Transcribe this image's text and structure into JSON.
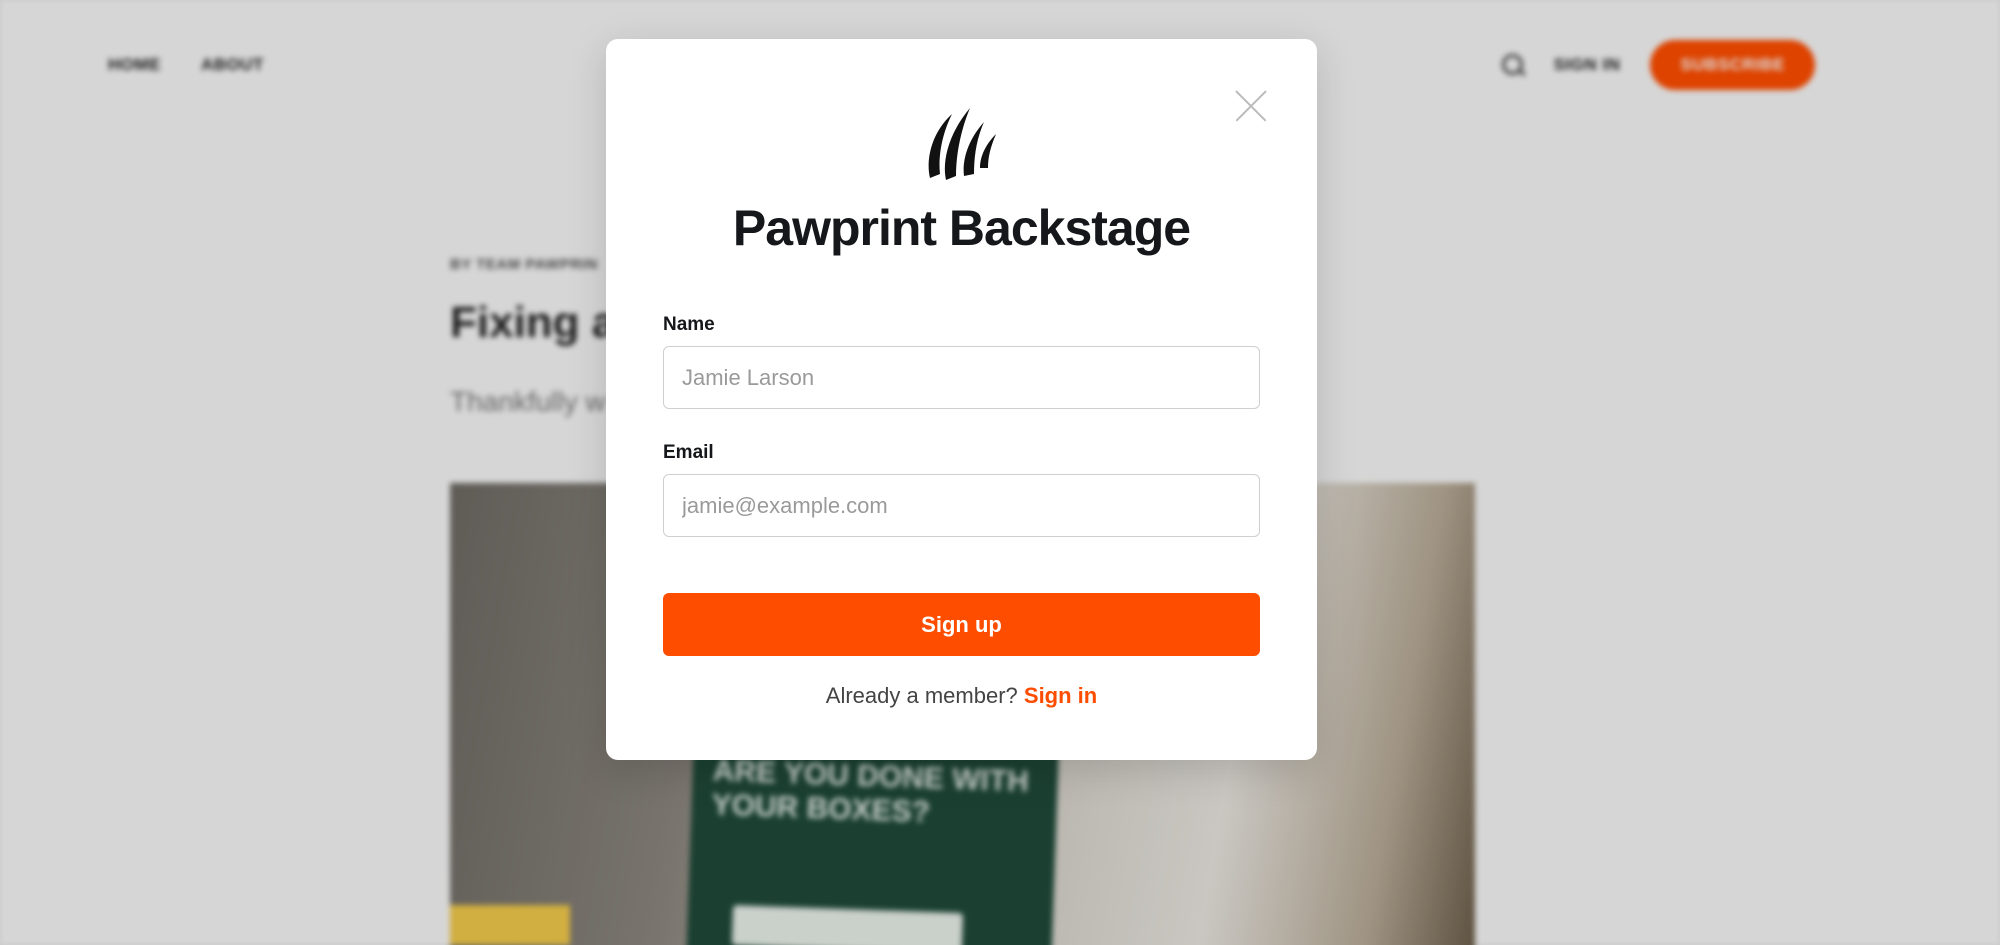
{
  "background_site": {
    "nav_left": [
      "HOME",
      "ABOUT"
    ],
    "sign_in": "SIGN IN",
    "subscribe": "SUBSCRIBE",
    "byline": "BY TEAM PAWPRIN",
    "title_fragment": "Fixing a",
    "subtitle_fragment": "Thankfully w",
    "poster_text": "ARE YOU DONE WITH YOUR BOXES?"
  },
  "modal": {
    "brand_name": "Pawprint Backstage",
    "logo_icon": "claw-marks-icon",
    "close_icon": "close-icon",
    "name_label": "Name",
    "name_placeholder": "Jamie Larson",
    "name_value": "",
    "email_label": "Email",
    "email_placeholder": "jamie@example.com",
    "email_value": "",
    "signup_label": "Sign up",
    "member_prompt": "Already a member?",
    "signin_link": "Sign in"
  },
  "colors": {
    "accent": "#ff4d00",
    "text_dark": "#15171a",
    "overlay": "rgba(0,0,0,0.13)"
  }
}
